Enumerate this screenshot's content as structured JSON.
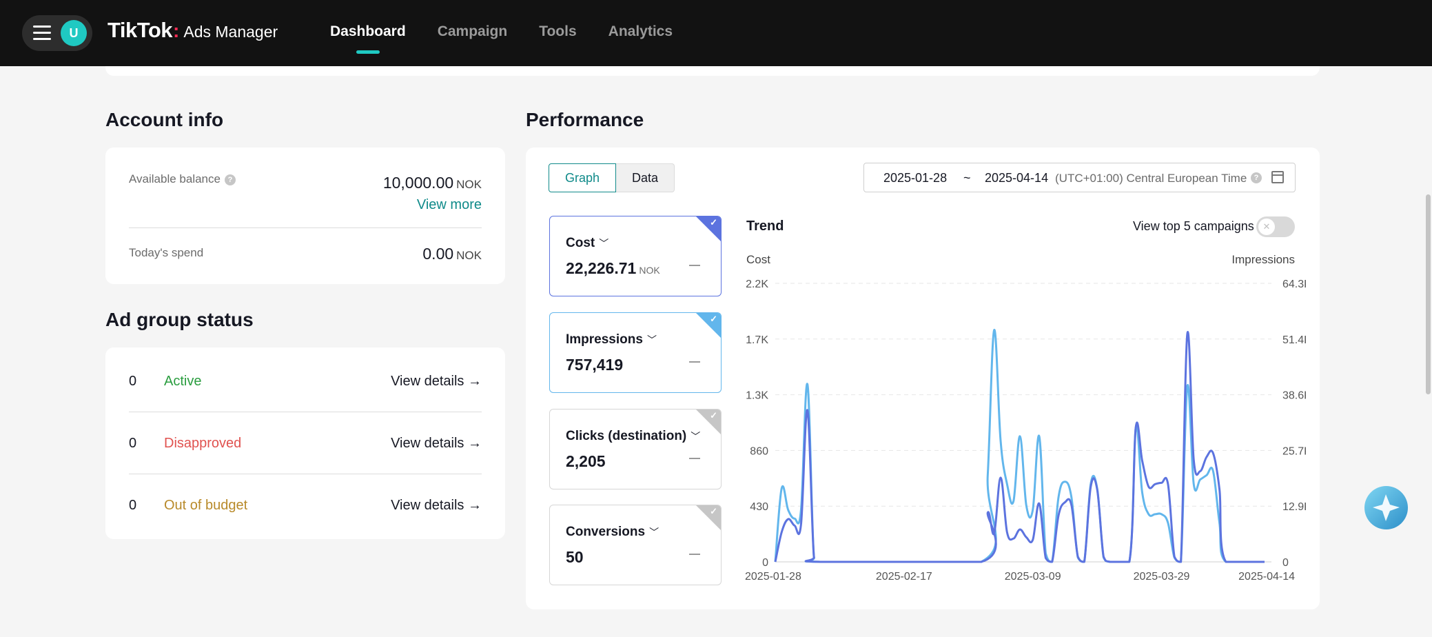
{
  "header": {
    "avatar_letter": "U",
    "brand_name": "TikTok",
    "brand_sub": "Ads Manager",
    "nav": [
      "Dashboard",
      "Campaign",
      "Tools",
      "Analytics"
    ],
    "active_nav": "Dashboard"
  },
  "account_info": {
    "title": "Account info",
    "balance_label": "Available balance",
    "balance_value": "10,000.00",
    "balance_unit": "NOK",
    "view_more": "View more",
    "spend_label": "Today's spend",
    "spend_value": "0.00",
    "spend_unit": "NOK"
  },
  "ad_group_status": {
    "title": "Ad group status",
    "rows": [
      {
        "count": "0",
        "status": "Active",
        "color": "#2a9d3f",
        "link": "View details →"
      },
      {
        "count": "0",
        "status": "Disapproved",
        "color": "#e0524f",
        "link": "View details →"
      },
      {
        "count": "0",
        "status": "Out of budget",
        "color": "#b88a2a",
        "link": "View details →"
      }
    ]
  },
  "performance": {
    "title": "Performance",
    "view_tabs": [
      "Graph",
      "Data"
    ],
    "active_tab": "Graph",
    "date_start": "2025-01-28",
    "date_sep": "~",
    "date_end": "2025-04-14",
    "timezone": "(UTC+01:00) Central European Time",
    "metrics": [
      {
        "name": "Cost",
        "value": "22,226.71",
        "unit": "NOK",
        "selected": "dark"
      },
      {
        "name": "Impressions",
        "value": "757,419",
        "unit": "",
        "selected": "light"
      },
      {
        "name": "Clicks (destination)",
        "value": "2,205",
        "unit": "",
        "selected": "none"
      },
      {
        "name": "Conversions",
        "value": "50",
        "unit": "",
        "selected": "none"
      }
    ],
    "trend_title": "Trend",
    "top5_label": "View top 5 campaigns",
    "top5_enabled": false
  },
  "chart_data": {
    "type": "line",
    "title": "Trend",
    "xlabel": "",
    "ylabel": "Cost",
    "y2label": "Impressions",
    "ylim": [
      0,
      2150
    ],
    "y2lim": [
      0,
      64300
    ],
    "y_ticks": [
      "0",
      "430",
      "860",
      "1.3K",
      "1.7K",
      "2.2K"
    ],
    "y2_ticks": [
      "0",
      "12.9K",
      "25.7K",
      "38.6K",
      "51.4K",
      "64.3K"
    ],
    "x_ticks": [
      "2025-01-28",
      "2025-02-17",
      "2025-03-09",
      "2025-03-29",
      "2025-04-14"
    ],
    "colors": {
      "Cost": "#5c73df",
      "Impressions": "#62b6ec"
    },
    "grid": true,
    "legend": "none",
    "series": [
      {
        "name": "Cost",
        "axis": "left",
        "points": [
          [
            "2025-01-28",
            0
          ],
          [
            "2025-01-29",
            230
          ],
          [
            "2025-01-30",
            330
          ],
          [
            "2025-01-31",
            280
          ],
          [
            "2025-02-01",
            290
          ],
          [
            "2025-02-02",
            1170
          ],
          [
            "2025-02-03",
            40
          ],
          [
            "2025-02-04",
            0
          ],
          [
            "2025-03-01",
            0
          ],
          [
            "2025-03-02",
            380
          ],
          [
            "2025-03-03",
            220
          ],
          [
            "2025-03-04",
            650
          ],
          [
            "2025-03-05",
            230
          ],
          [
            "2025-03-06",
            180
          ],
          [
            "2025-03-07",
            250
          ],
          [
            "2025-03-08",
            190
          ],
          [
            "2025-03-09",
            170
          ],
          [
            "2025-03-10",
            450
          ],
          [
            "2025-03-11",
            30
          ],
          [
            "2025-03-12",
            0
          ],
          [
            "2025-03-13",
            360
          ],
          [
            "2025-03-14",
            460
          ],
          [
            "2025-03-15",
            440
          ],
          [
            "2025-03-16",
            40
          ],
          [
            "2025-03-17",
            0
          ],
          [
            "2025-03-18",
            580
          ],
          [
            "2025-03-19",
            560
          ],
          [
            "2025-03-20",
            40
          ],
          [
            "2025-03-21",
            0
          ],
          [
            "2025-03-24",
            0
          ],
          [
            "2025-03-25",
            1040
          ],
          [
            "2025-03-26",
            780
          ],
          [
            "2025-03-27",
            580
          ],
          [
            "2025-03-28",
            600
          ],
          [
            "2025-03-29",
            610
          ],
          [
            "2025-03-30",
            600
          ],
          [
            "2025-03-31",
            40
          ],
          [
            "2025-04-01",
            0
          ],
          [
            "2025-04-02",
            1760
          ],
          [
            "2025-04-03",
            790
          ],
          [
            "2025-04-04",
            700
          ],
          [
            "2025-04-05",
            810
          ],
          [
            "2025-04-06",
            840
          ],
          [
            "2025-04-07",
            560
          ],
          [
            "2025-04-08",
            0
          ],
          [
            "2025-04-14",
            0
          ]
        ]
      },
      {
        "name": "Impressions",
        "axis": "right",
        "points": [
          [
            "2025-01-28",
            0
          ],
          [
            "2025-01-29",
            17000
          ],
          [
            "2025-01-30",
            12000
          ],
          [
            "2025-01-31",
            10000
          ],
          [
            "2025-02-01",
            12000
          ],
          [
            "2025-02-02",
            41000
          ],
          [
            "2025-02-03",
            1000
          ],
          [
            "2025-02-04",
            0
          ],
          [
            "2025-03-01",
            0
          ],
          [
            "2025-03-02",
            20000
          ],
          [
            "2025-03-03",
            53500
          ],
          [
            "2025-03-04",
            28000
          ],
          [
            "2025-03-05",
            18000
          ],
          [
            "2025-03-06",
            14000
          ],
          [
            "2025-03-07",
            29000
          ],
          [
            "2025-03-08",
            13000
          ],
          [
            "2025-03-09",
            12000
          ],
          [
            "2025-03-10",
            29000
          ],
          [
            "2025-03-11",
            2000
          ],
          [
            "2025-03-12",
            0
          ],
          [
            "2025-03-13",
            15000
          ],
          [
            "2025-03-14",
            18500
          ],
          [
            "2025-03-15",
            15000
          ],
          [
            "2025-03-16",
            1000
          ],
          [
            "2025-03-17",
            0
          ],
          [
            "2025-03-18",
            18000
          ],
          [
            "2025-03-19",
            17000
          ],
          [
            "2025-03-20",
            1000
          ],
          [
            "2025-03-21",
            0
          ],
          [
            "2025-03-24",
            0
          ],
          [
            "2025-03-25",
            31000
          ],
          [
            "2025-03-26",
            16000
          ],
          [
            "2025-03-27",
            11000
          ],
          [
            "2025-03-28",
            11000
          ],
          [
            "2025-03-29",
            11000
          ],
          [
            "2025-03-30",
            9000
          ],
          [
            "2025-03-31",
            1000
          ],
          [
            "2025-04-01",
            0
          ],
          [
            "2025-04-02",
            40500
          ],
          [
            "2025-04-03",
            18000
          ],
          [
            "2025-04-04",
            19000
          ],
          [
            "2025-04-05",
            20000
          ],
          [
            "2025-04-06",
            21000
          ],
          [
            "2025-04-07",
            9000
          ],
          [
            "2025-04-08",
            0
          ],
          [
            "2025-04-14",
            0
          ]
        ]
      }
    ]
  }
}
